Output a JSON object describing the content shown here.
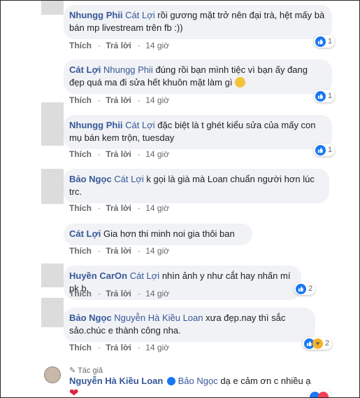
{
  "comments": [
    {
      "author": "Nhungg Phii",
      "tag": "Cát Lợi",
      "text": "rồi gương mặt trở nên đại trà, hệt mấy bà bán mp livestream trên fb :))",
      "like": "Thích",
      "reply": "Trả lời",
      "time": "14 giờ",
      "reactions": "1"
    },
    {
      "author": "Cát Lợi",
      "tag": "Nhungg Phii",
      "text": "đúng rồi bạn mình tiệc vì bạn ấy đang đẹp quá ma đi sửa hết khuôn mặt làm gì",
      "like": "Thích",
      "reply": "Trả lời",
      "time": "14 giờ",
      "reactions": "1"
    },
    {
      "author": "Nhungg Phii",
      "tag": "Cát Lợi",
      "text": "đặc biệt là t ghét kiểu sửa của mấy con mụ bán kem trộn, tuesday",
      "like": "Thích",
      "reply": "Trả lời",
      "time": "14 giờ",
      "reactions": "1"
    },
    {
      "author": "Bảo Ngọc",
      "tag": "Cát Lợi",
      "text": "k gọi là già mà Loan chuẩn người hơn lúc trc.",
      "like": "Thích",
      "reply": "Trả lời",
      "time": "14 giờ",
      "reactions": ""
    },
    {
      "author": "Cát Lợi",
      "tag": "",
      "text": "Gia hơn thi minh noi gia thôi ban",
      "like": "Thích",
      "reply": "Trả lời",
      "time": "14 giờ",
      "reactions": ""
    },
    {
      "author": "Huyền CarOn",
      "tag": "Cát Lợi",
      "text": "nhìn ảnh y như cắt hay nhấn mí pk b",
      "like": "Thích",
      "reply": "Trả lời",
      "time": "14 giờ",
      "reactions": "2"
    },
    {
      "author": "Bảo Ngọc",
      "tag": "Nguyễn Hà Kiều Loan",
      "text": "xưa đẹp.nay thì sắc sảo.chúc e thành công nha.",
      "like": "Thích",
      "reply": "Trả lời",
      "time": "14 giờ",
      "reactions": "2"
    },
    {
      "author": "Nguyễn Hà Kiều Loan",
      "tag": "Bảo Ngọc",
      "text": "dạ e cảm ơn c nhiều ạ",
      "like": "",
      "reply": "",
      "time": "",
      "reactions": ""
    }
  ],
  "author_badge": "Tác giả",
  "colors": {
    "link": "#385898",
    "bubble": "#f0f2f5",
    "like": "#1877f2"
  }
}
